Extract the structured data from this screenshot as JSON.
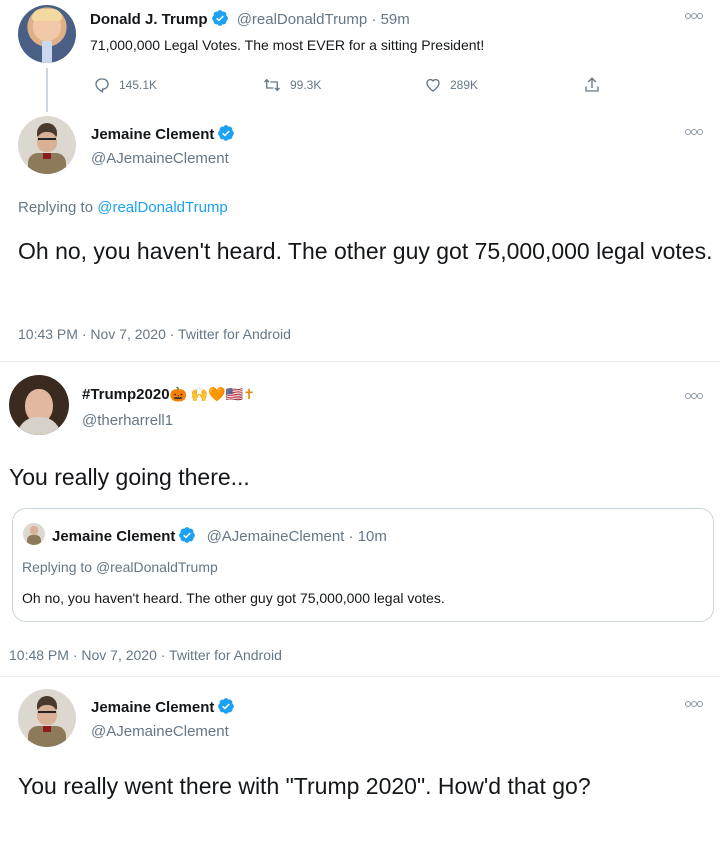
{
  "tweet1": {
    "name": "Donald J. Trump",
    "handle": "@realDonaldTrump",
    "sep": "·",
    "time": "59m",
    "text": "71,000,000 Legal Votes. The most EVER for a sitting President!",
    "replies": "145.1K",
    "retweets": "99.3K",
    "likes": "289K"
  },
  "tweet2": {
    "name": "Jemaine Clement",
    "handle": "@AJemaineClement",
    "replying_prefix": "Replying to",
    "replying_to": "@realDonaldTrump",
    "text": "Oh no, you haven't heard. The other guy got 75,000,000 legal votes.",
    "meta": "10:43 PM · Nov 7, 2020 · Twitter for Android"
  },
  "tweet3": {
    "name": "#Trump2020",
    "emoji": "🎃 🙌🧡🇺🇸✝",
    "handle": "@therharrell1",
    "text": "You really going there...",
    "meta": "10:48 PM · Nov 7, 2020 · Twitter for Android"
  },
  "quote": {
    "name": "Jemaine Clement",
    "handle": "@AJemaineClement",
    "sep": "·",
    "time": "10m",
    "replying_prefix": "Replying to",
    "replying_to": "@realDonaldTrump",
    "text": "Oh no, you haven't heard. The other guy got 75,000,000 legal votes."
  },
  "tweet4": {
    "name": "Jemaine Clement",
    "handle": "@AJemaineClement",
    "text": "You really went there with \"Trump 2020\". How'd that go?"
  },
  "colors": {
    "link": "#1da1f2",
    "muted": "#657786",
    "verified": "#1da1f2"
  },
  "icons": [
    "reply-icon",
    "retweet-icon",
    "like-icon",
    "share-icon",
    "verified-badge-icon",
    "more-options-icon"
  ]
}
